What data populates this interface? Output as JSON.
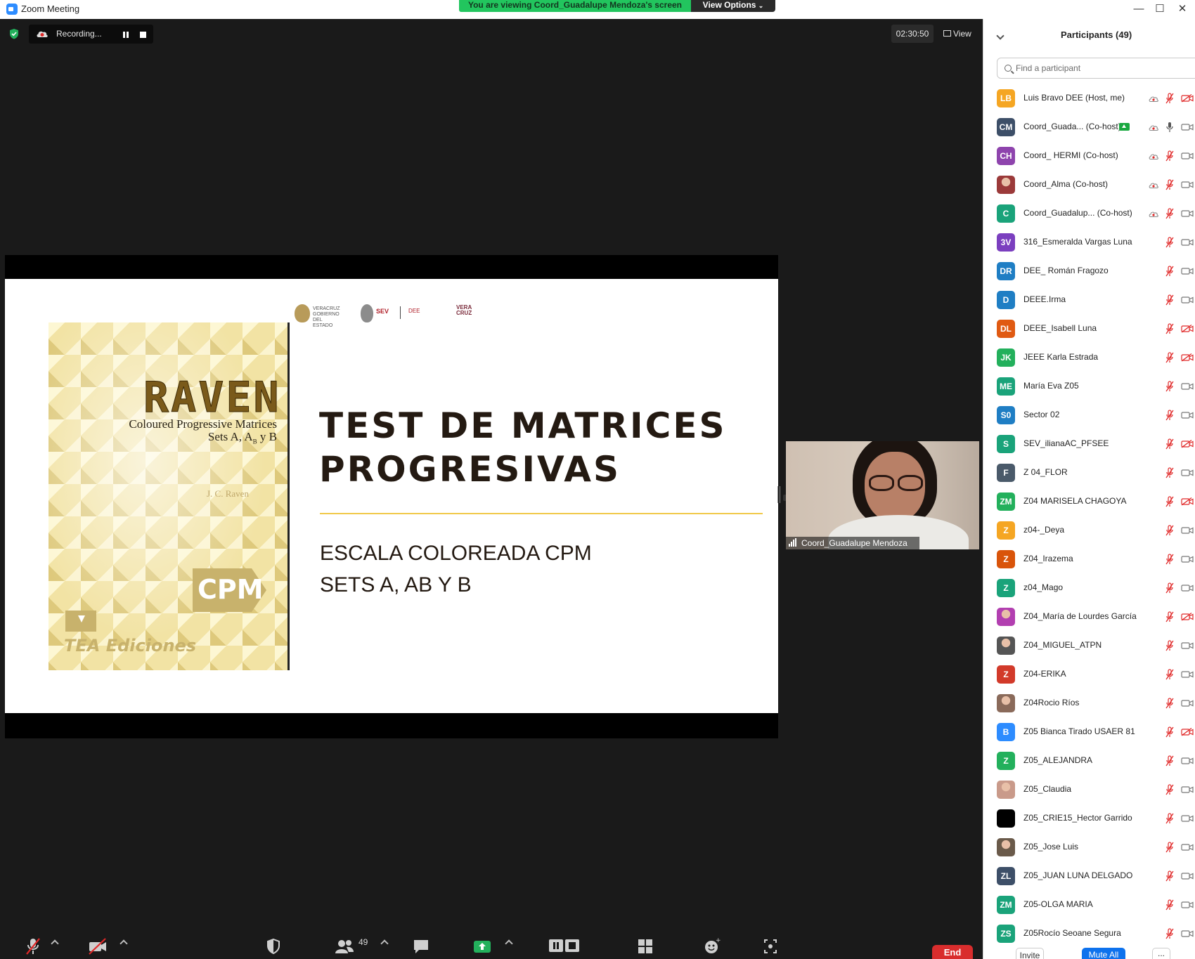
{
  "window": {
    "title": "Zoom Meeting",
    "share_banner": "You are viewing Coord_Guadalupe Mendoza's screen",
    "view_options_label": "View Options"
  },
  "topbar": {
    "recording_label": "Recording...",
    "timer": "02:30:50",
    "view_label": "View"
  },
  "slide": {
    "title_line1": "TEST DE MATRICES",
    "title_line2": "PROGRESIVAS",
    "subtitle_line1": "ESCALA COLOREADA CPM",
    "subtitle_line2": "SETS A, AB Y B",
    "logos": {
      "veracruz": "VERACRUZ GOBIERNO DEL ESTADO",
      "sev": "SEV",
      "dee": "DEE",
      "veracruz2": "VERA CRUZ"
    },
    "book": {
      "title": "RAVEN",
      "subtitle_line1": "Coloured Progressive Matrices",
      "subtitle_line2": "Sets A, A",
      "subtitle_sub": "B",
      "subtitle_end": " y B",
      "author": "J. C. Raven",
      "badge": "CPM",
      "publisher": "TEA Ediciones"
    }
  },
  "video": {
    "name": "Coord_Guadalupe Mendoza"
  },
  "toolbar": {
    "participants_count": "49",
    "end_label": "End"
  },
  "panel": {
    "title": "Participants (49)",
    "search_placeholder": "Find a participant",
    "participants": [
      {
        "initials": "LB",
        "name": "Luis Bravo DEE (Host, me)",
        "color": "#f5a623",
        "cloud": true,
        "mic": "muted",
        "cam": "off"
      },
      {
        "initials": "CM",
        "name": "Coord_Guada... (Co-host)",
        "color": "#3d4f68",
        "cloud": true,
        "mic": "on",
        "cam": "on",
        "sharing": true
      },
      {
        "initials": "CH",
        "name": "Coord_ HERMI (Co-host)",
        "color": "#8e44ad",
        "cloud": true,
        "mic": "muted",
        "cam": "on"
      },
      {
        "initials": "",
        "name": "Coord_Alma (Co-host)",
        "color": "#9b3a3a",
        "cloud": true,
        "mic": "muted",
        "cam": "on",
        "photo": true
      },
      {
        "initials": "C",
        "name": "Coord_Guadalup... (Co-host)",
        "color": "#1aa37a",
        "cloud": true,
        "mic": "muted",
        "cam": "on"
      },
      {
        "initials": "3V",
        "name": "316_Esmeralda Vargas Luna",
        "color": "#7b3fbf",
        "mic": "muted",
        "cam": "on"
      },
      {
        "initials": "DR",
        "name": "DEE_ Román Fragozo",
        "color": "#1f7ec4",
        "mic": "muted",
        "cam": "on"
      },
      {
        "initials": "D",
        "name": "DEEE.Irma",
        "color": "#1f7ec4",
        "mic": "muted",
        "cam": "on"
      },
      {
        "initials": "DL",
        "name": "DEEE_Isabell Luna",
        "color": "#e05a12",
        "mic": "muted",
        "cam": "off"
      },
      {
        "initials": "JK",
        "name": "JEEE Karla Estrada",
        "color": "#23b05c",
        "mic": "muted",
        "cam": "off"
      },
      {
        "initials": "ME",
        "name": "María Eva Z05",
        "color": "#1aa37a",
        "mic": "muted",
        "cam": "on"
      },
      {
        "initials": "S0",
        "name": "Sector 02",
        "color": "#1f7ec4",
        "mic": "muted",
        "cam": "on"
      },
      {
        "initials": "S",
        "name": "SEV_ilianaAC_PFSEE",
        "color": "#1aa37a",
        "mic": "muted",
        "cam": "off"
      },
      {
        "initials": "F",
        "name": "Z 04_FLOR",
        "color": "#4a5a6a",
        "mic": "muted",
        "cam": "on"
      },
      {
        "initials": "ZM",
        "name": "Z04 MARISELA CHAGOYA",
        "color": "#23b05c",
        "mic": "muted",
        "cam": "off"
      },
      {
        "initials": "Z",
        "name": "z04-_Deya",
        "color": "#f5a623",
        "mic": "muted",
        "cam": "on"
      },
      {
        "initials": "Z",
        "name": "Z04_Irazema",
        "color": "#d9540a",
        "mic": "muted",
        "cam": "on"
      },
      {
        "initials": "Z",
        "name": "z04_Mago",
        "color": "#1aa37a",
        "mic": "muted",
        "cam": "on"
      },
      {
        "initials": "",
        "name": "Z04_María de Lourdes García",
        "color": "#b23fb0",
        "mic": "muted",
        "cam": "off",
        "photo": true
      },
      {
        "initials": "",
        "name": "Z04_MIGUEL_ATPN",
        "color": "#555555",
        "mic": "muted",
        "cam": "on",
        "photo": true
      },
      {
        "initials": "Z",
        "name": "Z04-ERIKA",
        "color": "#d23a2a",
        "mic": "muted",
        "cam": "on"
      },
      {
        "initials": "",
        "name": "Z04Rocio Ríos",
        "color": "#8a6a5a",
        "mic": "muted",
        "cam": "on",
        "photo": true
      },
      {
        "initials": "B",
        "name": "Z05 Bianca Tirado USAER 81",
        "color": "#2d8cff",
        "mic": "muted",
        "cam": "off"
      },
      {
        "initials": "Z",
        "name": "Z05_ALEJANDRA",
        "color": "#23b05c",
        "mic": "muted",
        "cam": "on"
      },
      {
        "initials": "",
        "name": "Z05_Claudia",
        "color": "#c99a8a",
        "mic": "muted",
        "cam": "on",
        "photo": true
      },
      {
        "initials": "",
        "name": "Z05_CRIE15_Hector Garrido",
        "color": "#000000",
        "mic": "muted",
        "cam": "on"
      },
      {
        "initials": "",
        "name": "Z05_Jose Luis",
        "color": "#6a5a4a",
        "mic": "muted",
        "cam": "on",
        "photo": true
      },
      {
        "initials": "ZL",
        "name": "Z05_JUAN LUNA DELGADO",
        "color": "#3d4f68",
        "mic": "muted",
        "cam": "on"
      },
      {
        "initials": "ZM",
        "name": "Z05-OLGA MARIA",
        "color": "#1aa37a",
        "mic": "muted",
        "cam": "on"
      },
      {
        "initials": "ZS",
        "name": "Z05Rocío Seoane Segura",
        "color": "#1aa37a",
        "mic": "muted",
        "cam": "on"
      }
    ],
    "invite_label": "Invite",
    "mute_all_label": "Mute All",
    "more_label": "..."
  }
}
